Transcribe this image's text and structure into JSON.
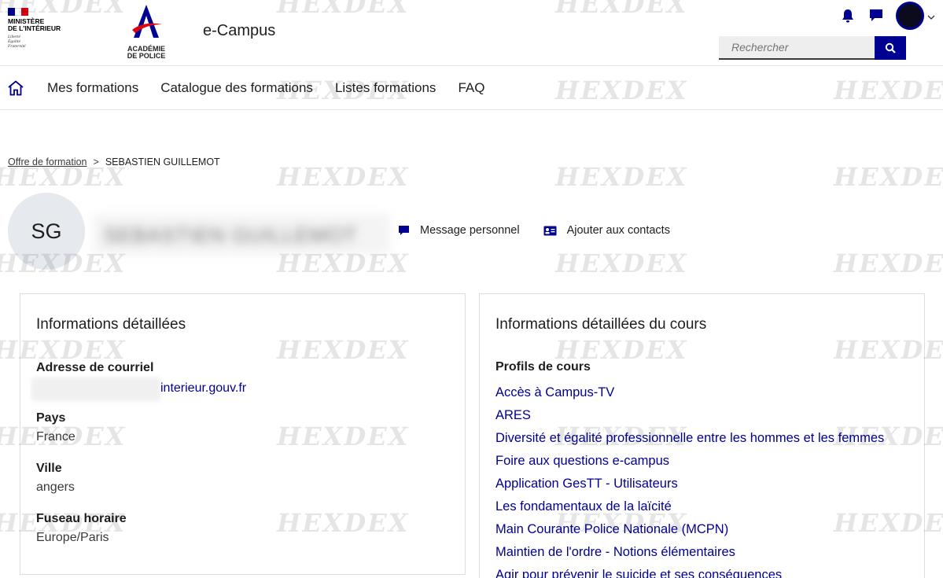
{
  "header": {
    "ministry_name_line1": "MINISTÈRE",
    "ministry_name_line2": "DE L'INTÉRIEUR",
    "motto_line1": "Liberté",
    "motto_line2": "Égalité",
    "motto_line3": "Fraternité",
    "academy_line1": "ACADÉMIE",
    "academy_line2": "DE POLICE",
    "app_title": "e-Campus",
    "search_placeholder": "Rechercher",
    "icons": [
      "bell-icon",
      "chat-icon",
      "avatar",
      "chevron-down-icon",
      "search-icon"
    ]
  },
  "nav": {
    "items": [
      {
        "label": "Mes formations"
      },
      {
        "label": "Catalogue des formations"
      },
      {
        "label": "Listes formations"
      },
      {
        "label": "FAQ"
      }
    ]
  },
  "breadcrumb": {
    "link": "Offre de formation",
    "separator": ">",
    "current": "SEBASTIEN GUILLEMOT"
  },
  "profile": {
    "initials": "SG",
    "name_blurred": "SEBASTIEN GUILLEMOT",
    "actions": [
      {
        "label": "Message personnel",
        "icon": "message-icon"
      },
      {
        "label": "Ajouter aux contacts",
        "icon": "contact-card-icon"
      }
    ]
  },
  "details": {
    "title": "Informations détaillées",
    "email_label": "Adresse de courriel",
    "email_suffix": "interieur.gouv.fr",
    "country_label": "Pays",
    "country_value": "France",
    "city_label": "Ville",
    "city_value": "angers",
    "timezone_label": "Fuseau horaire",
    "timezone_value": "Europe/Paris"
  },
  "course_details": {
    "title": "Informations détaillées du cours",
    "profiles_label": "Profils de cours",
    "courses": [
      "Accès à Campus-TV",
      "ARES",
      "Diversité et égalité professionnelle entre les hommes et les femmes",
      "Foire aux questions e-campus",
      "Application GesTT - Utilisateurs",
      "Les fondamentaux de la laïcité",
      "Main Courante Police Nationale (MCPN)",
      "Maintien de l'ordre - Notions élémentaires",
      "Agir pour prévenir le suicide et ses conséquences"
    ]
  },
  "watermark": "HEXDEX",
  "colors": {
    "accent": "#000091",
    "flag_blue": "#000091",
    "flag_red": "#e1000f",
    "avatar_bg": "#e6e9ee"
  }
}
